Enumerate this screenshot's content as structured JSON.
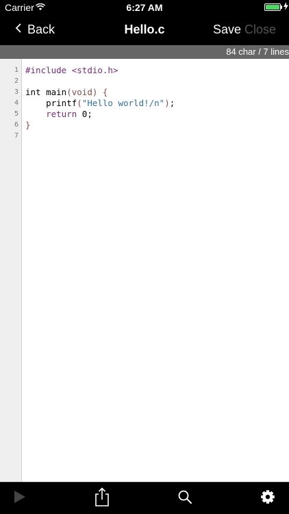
{
  "status": {
    "carrier": "Carrier",
    "time": "6:27 AM"
  },
  "nav": {
    "back_label": "Back",
    "title": "Hello.c",
    "save_label": "Save",
    "close_label": "Close"
  },
  "info": {
    "count": "84 char / 7 lines"
  },
  "editor": {
    "line_numbers": [
      "1",
      "2",
      "3",
      "4",
      "5",
      "6",
      "7"
    ],
    "line1": {
      "directive": "#include",
      "header": " <stdio.h>"
    },
    "line3": {
      "type": "int",
      "name": " main",
      "open_paren": "(",
      "param": "void",
      "close_paren": ")",
      "brace": " {"
    },
    "line4": {
      "indent": "    ",
      "func": "printf",
      "open_paren": "(",
      "string": "\"Hello world!/n\"",
      "close_paren": ")",
      "semicolon": ";"
    },
    "line5": {
      "indent": "    ",
      "keyword": "return",
      "value": " 0;"
    },
    "line6": {
      "brace": "}"
    }
  },
  "toolbar": {
    "icons": [
      "play-icon",
      "share-icon",
      "search-icon",
      "gear-icon"
    ]
  },
  "colors": {
    "battery": "#4cd964",
    "info_bar": "#666666",
    "gutter": "#efefef",
    "directive": "#7a2a7a",
    "string": "#2f6fa5"
  }
}
